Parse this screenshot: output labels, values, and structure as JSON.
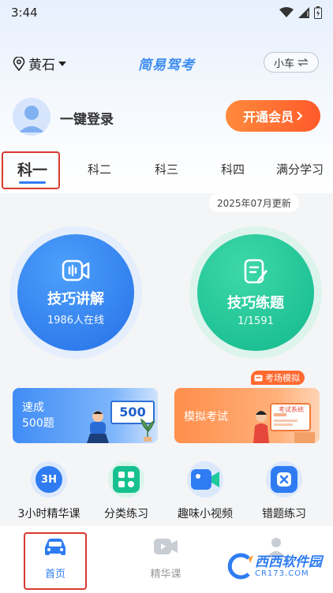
{
  "status_bar": {
    "time": "3:44"
  },
  "header": {
    "location": "黄石",
    "app_title": "简易驾考",
    "vehicle_label": "小车",
    "vehicle_icon": "swap-icon"
  },
  "profile": {
    "login_text": "一键登录",
    "vip_button": "开通会员"
  },
  "tabs": [
    {
      "label": "科一",
      "active": true
    },
    {
      "label": "科二"
    },
    {
      "label": "科三"
    },
    {
      "label": "科四"
    },
    {
      "label": "满分学习"
    }
  ],
  "update_badge": "2025年07月更新",
  "circles": {
    "skills_lecture": {
      "title": "技巧讲解",
      "subtitle": "1986人在线"
    },
    "skills_practice": {
      "title": "技巧练题",
      "subtitle": "1/1591"
    }
  },
  "banners": {
    "speed": {
      "line1": "速成",
      "line2": "500题",
      "board_number": "500"
    },
    "mock": {
      "label": "模拟考试",
      "badge": "考场模拟",
      "screen_text": "考试系统"
    }
  },
  "features": [
    {
      "label": "3小时精华课",
      "icon_text": "3H"
    },
    {
      "label": "分类练习"
    },
    {
      "label": "趣味小视频"
    },
    {
      "label": "错题练习"
    }
  ],
  "bottom_nav": {
    "home": "首页",
    "featured": "精华课"
  },
  "watermark": {
    "brand": "西西软件园",
    "url": "CR173.COM"
  },
  "colors": {
    "primary": "#2f7cf2",
    "title_blue": "#3b8cf0",
    "vip_orange": "#ff6a30",
    "practice_green": "#19c79a",
    "highlight_red": "#d93a2f"
  }
}
